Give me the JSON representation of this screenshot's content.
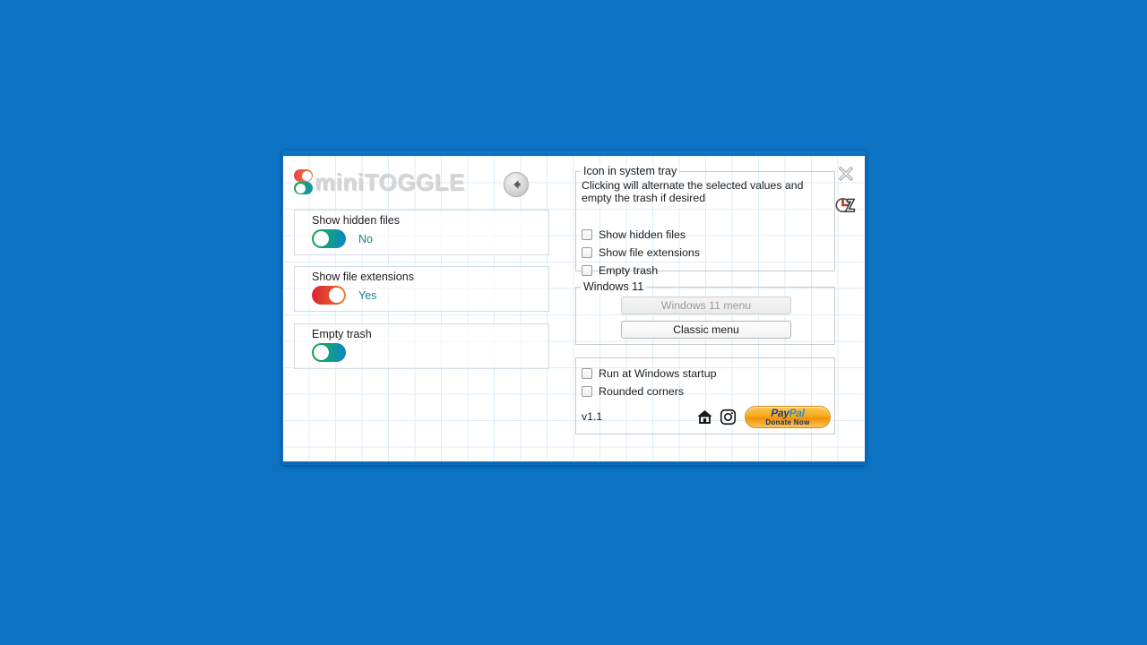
{
  "app": {
    "logo_text": "miniTOGGLE",
    "version": "v1.1"
  },
  "titlebar": {
    "back_button": "back-arrow",
    "close_button": "close"
  },
  "left_panel": {
    "groups": [
      {
        "label": "Show hidden files",
        "state": "off",
        "value": "No"
      },
      {
        "label": "Show file extensions",
        "state": "on",
        "value": "Yes"
      },
      {
        "label": "Empty trash",
        "state": "off",
        "value": ""
      }
    ]
  },
  "right_panel": {
    "tray_group": {
      "legend": "Icon in system tray",
      "description": "Clicking will alternate the selected values and empty the trash if desired",
      "checkboxes": [
        {
          "label": "Show hidden files",
          "checked": false
        },
        {
          "label": "Show file extensions",
          "checked": false
        },
        {
          "label": "Empty trash",
          "checked": false
        }
      ]
    },
    "windows_group": {
      "legend": "Windows 11",
      "buttons": [
        {
          "label": "Windows 11 menu",
          "disabled": true
        },
        {
          "label": "Classic menu",
          "disabled": false
        }
      ]
    },
    "misc_group": {
      "checkboxes": [
        {
          "label": "Run at Windows startup",
          "checked": false
        },
        {
          "label": "Rounded corners",
          "checked": false
        }
      ]
    },
    "footer": {
      "version": "v1.1",
      "icons": [
        "home-icon",
        "instagram-icon"
      ],
      "paypal": {
        "brand_pay": "Pay",
        "brand_pal": "Pal",
        "tm": "™",
        "subtitle": "Donate Now"
      }
    }
  },
  "colors": {
    "desktop": "#0b72c4",
    "toggle_off": "#12a085",
    "toggle_on": "#e3502f",
    "value_text": "#1b7f86",
    "paypal_orange": "#f6ab1c"
  }
}
